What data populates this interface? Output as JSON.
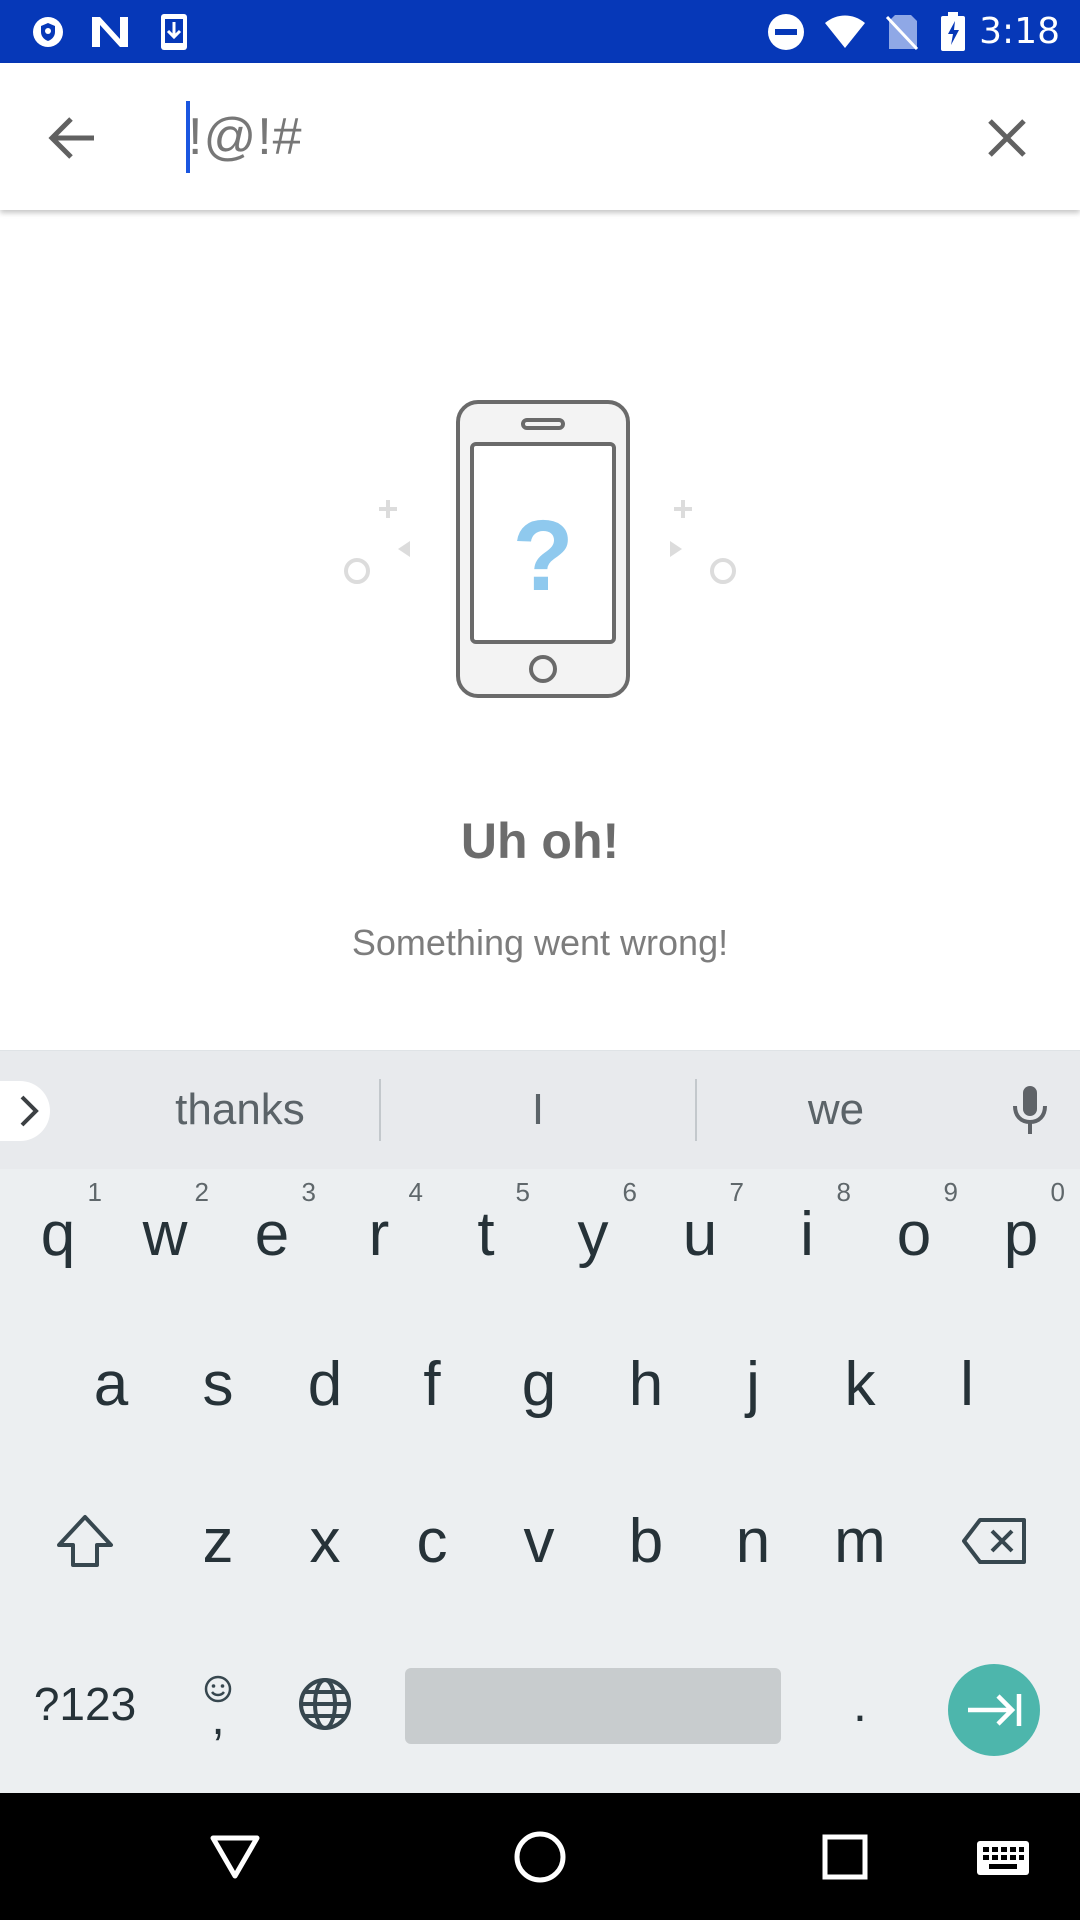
{
  "status_bar": {
    "time": "3:18",
    "icons_left": [
      "vpn-shield-icon",
      "n-app-icon",
      "download-icon"
    ],
    "icons_right": [
      "do-not-disturb-icon",
      "wifi-icon",
      "no-sim-icon",
      "battery-charging-icon"
    ],
    "background": "#0638b8"
  },
  "search": {
    "query": "!@!#",
    "back_icon": "arrow-back-icon",
    "clear_icon": "close-icon"
  },
  "empty_state": {
    "title": "Uh oh!",
    "message": "Something went wrong!",
    "illustration_icon": "phone-question-icon",
    "accent_color": "#8fc9ee"
  },
  "keyboard": {
    "suggestions": [
      "thanks",
      "I",
      "we"
    ],
    "row1": [
      {
        "key": "q",
        "hint": "1"
      },
      {
        "key": "w",
        "hint": "2"
      },
      {
        "key": "e",
        "hint": "3"
      },
      {
        "key": "r",
        "hint": "4"
      },
      {
        "key": "t",
        "hint": "5"
      },
      {
        "key": "y",
        "hint": "6"
      },
      {
        "key": "u",
        "hint": "7"
      },
      {
        "key": "i",
        "hint": "8"
      },
      {
        "key": "o",
        "hint": "9"
      },
      {
        "key": "p",
        "hint": "0"
      }
    ],
    "row2": [
      "a",
      "s",
      "d",
      "f",
      "g",
      "h",
      "j",
      "k",
      "l"
    ],
    "row3": [
      "z",
      "x",
      "c",
      "v",
      "b",
      "n",
      "m"
    ],
    "symbols_label": "?123",
    "comma_label": ",",
    "period_label": ".",
    "enter_color": "#4db6ac"
  }
}
